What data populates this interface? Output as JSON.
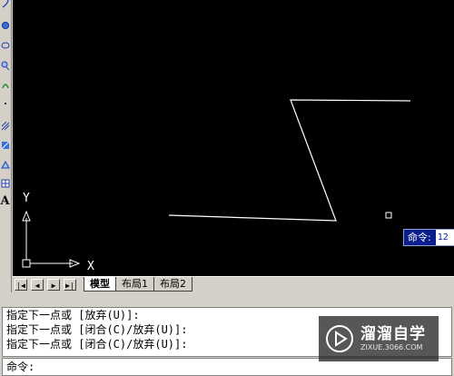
{
  "canvas": {
    "background": "#000000",
    "ucs_labels": {
      "y": "Y",
      "x": "X"
    },
    "floating_command": {
      "label": "命令:",
      "value": "12"
    }
  },
  "toolbar": {
    "tools": [
      "arc-icon",
      "circle-icon",
      "revision-cloud-icon",
      "spline-icon",
      "ellipse-icon",
      "insert-block-icon",
      "make-block-icon",
      "point-icon",
      "hatch-icon",
      "gradient-icon",
      "region-icon",
      "table-icon",
      "multiline-text-icon"
    ],
    "text_tool_label": "A"
  },
  "tabs": {
    "nav": [
      "|◀",
      "◀",
      "▶",
      "▶|"
    ],
    "items": [
      {
        "label": "模型",
        "active": true
      },
      {
        "label": "布局1",
        "active": false
      },
      {
        "label": "布局2",
        "active": false
      }
    ]
  },
  "command_window": {
    "history": [
      "指定下一点或 [放弃(U)]:",
      "指定下一点或 [闭合(C)/放弃(U)]:",
      "指定下一点或 [闭合(C)/放弃(U)]:"
    ],
    "prompt": "命令:"
  },
  "watermark": {
    "title": "溜溜自学",
    "subtitle": "ZIXUE.3066.COM"
  }
}
